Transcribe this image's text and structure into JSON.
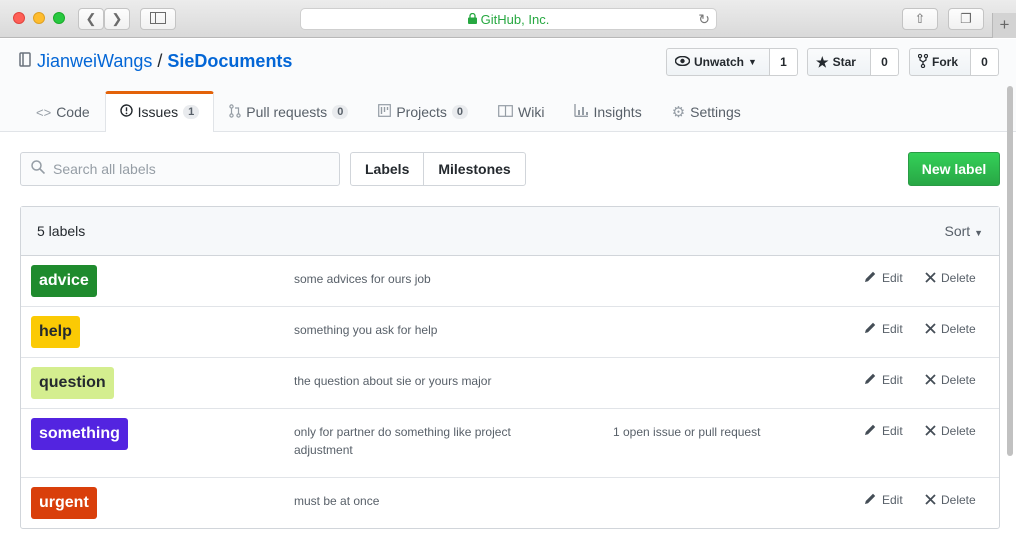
{
  "browser": {
    "url": "GitHub, Inc."
  },
  "repo": {
    "owner": "JianweiWangs",
    "separator": "/",
    "name": "SieDocuments",
    "watch": {
      "label": "Unwatch",
      "count": "1"
    },
    "star": {
      "label": "Star",
      "count": "0"
    },
    "fork": {
      "label": "Fork",
      "count": "0"
    }
  },
  "tabs": [
    {
      "label": "Code",
      "icon": "code-icon"
    },
    {
      "label": "Issues",
      "icon": "issue-icon",
      "badge": "1",
      "active": true
    },
    {
      "label": "Pull requests",
      "icon": "pull-request-icon",
      "badge": "0"
    },
    {
      "label": "Projects",
      "icon": "project-icon",
      "badge": "0"
    },
    {
      "label": "Wiki",
      "icon": "book-icon"
    },
    {
      "label": "Insights",
      "icon": "graph-icon"
    },
    {
      "label": "Settings",
      "icon": "gear-icon"
    }
  ],
  "search": {
    "placeholder": "Search all labels",
    "value": ""
  },
  "segmented": {
    "labels": "Labels",
    "milestones": "Milestones"
  },
  "new_label_button": "New label",
  "list": {
    "count_text": "5 labels",
    "sort": "Sort",
    "edit": "Edit",
    "delete": "Delete",
    "labels": [
      {
        "name": "advice",
        "description": "some advices for ours job",
        "issues": "",
        "color": "#1f8b2e",
        "text_color": "#ffffff"
      },
      {
        "name": "help",
        "description": "something you ask for help",
        "issues": "",
        "color": "#fbca04",
        "text_color": "#24292e"
      },
      {
        "name": "question",
        "description": "the question about sie or yours major",
        "issues": "",
        "color": "#d4ee8f",
        "text_color": "#24292e"
      },
      {
        "name": "something",
        "description": "only for partner do something like project adjustment",
        "issues": "1 open issue or pull request",
        "color": "#5324e0",
        "text_color": "#ffffff"
      },
      {
        "name": "urgent",
        "description": "must be at once",
        "issues": "",
        "color": "#d93f0b",
        "text_color": "#ffffff"
      }
    ]
  }
}
